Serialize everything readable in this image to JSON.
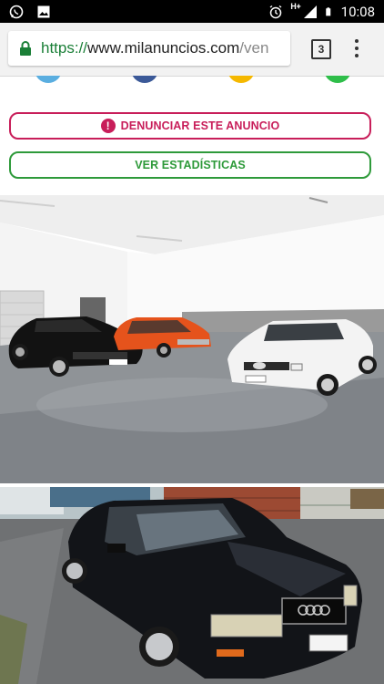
{
  "status_bar": {
    "time": "10:08",
    "network": "H+",
    "left_icons": [
      "whatsapp-icon",
      "image-icon"
    ],
    "right_icons": [
      "alarm-icon",
      "signal-icon",
      "battery-icon"
    ]
  },
  "browser": {
    "url_scheme": "https://",
    "url_host": "www.milanuncios.com",
    "url_rest": "/ven",
    "tab_count": "3"
  },
  "actions": {
    "report_label": "DENUNCIAR ESTE ANUNCIO",
    "stats_label": "VER ESTADÍSTICAS"
  },
  "colors": {
    "report": "#c81e5a",
    "stats": "#2e9a3a",
    "url_scheme": "#1a7f37"
  },
  "photos": [
    {
      "name": "garage-cars-photo"
    },
    {
      "name": "audi-v8-photo"
    }
  ]
}
